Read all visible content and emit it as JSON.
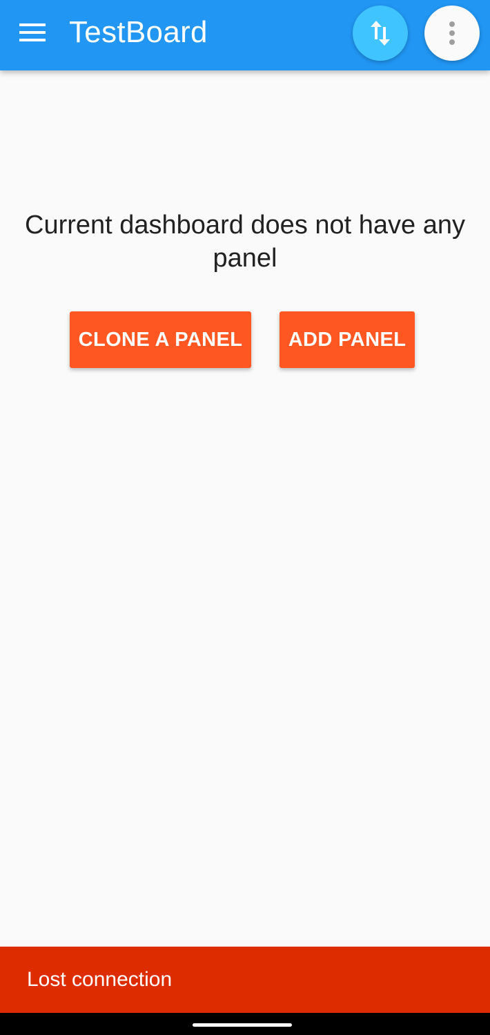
{
  "appbar": {
    "title": "TestBoard",
    "menu_icon": "hamburger-menu-icon",
    "sync_icon": "swap-vertical-icon",
    "more_icon": "more-vert-icon"
  },
  "empty_state": {
    "message": "Current dashboard does not have any panel",
    "clone_label": "CLONE A PANEL",
    "add_label": "ADD PANEL"
  },
  "snackbar": {
    "message": "Lost connection"
  },
  "colors": {
    "appbar": "#2196f3",
    "sync_button": "#40c4ff",
    "accent_button": "#ff5722",
    "snackbar": "#dd2c00",
    "background": "#fafafa"
  }
}
